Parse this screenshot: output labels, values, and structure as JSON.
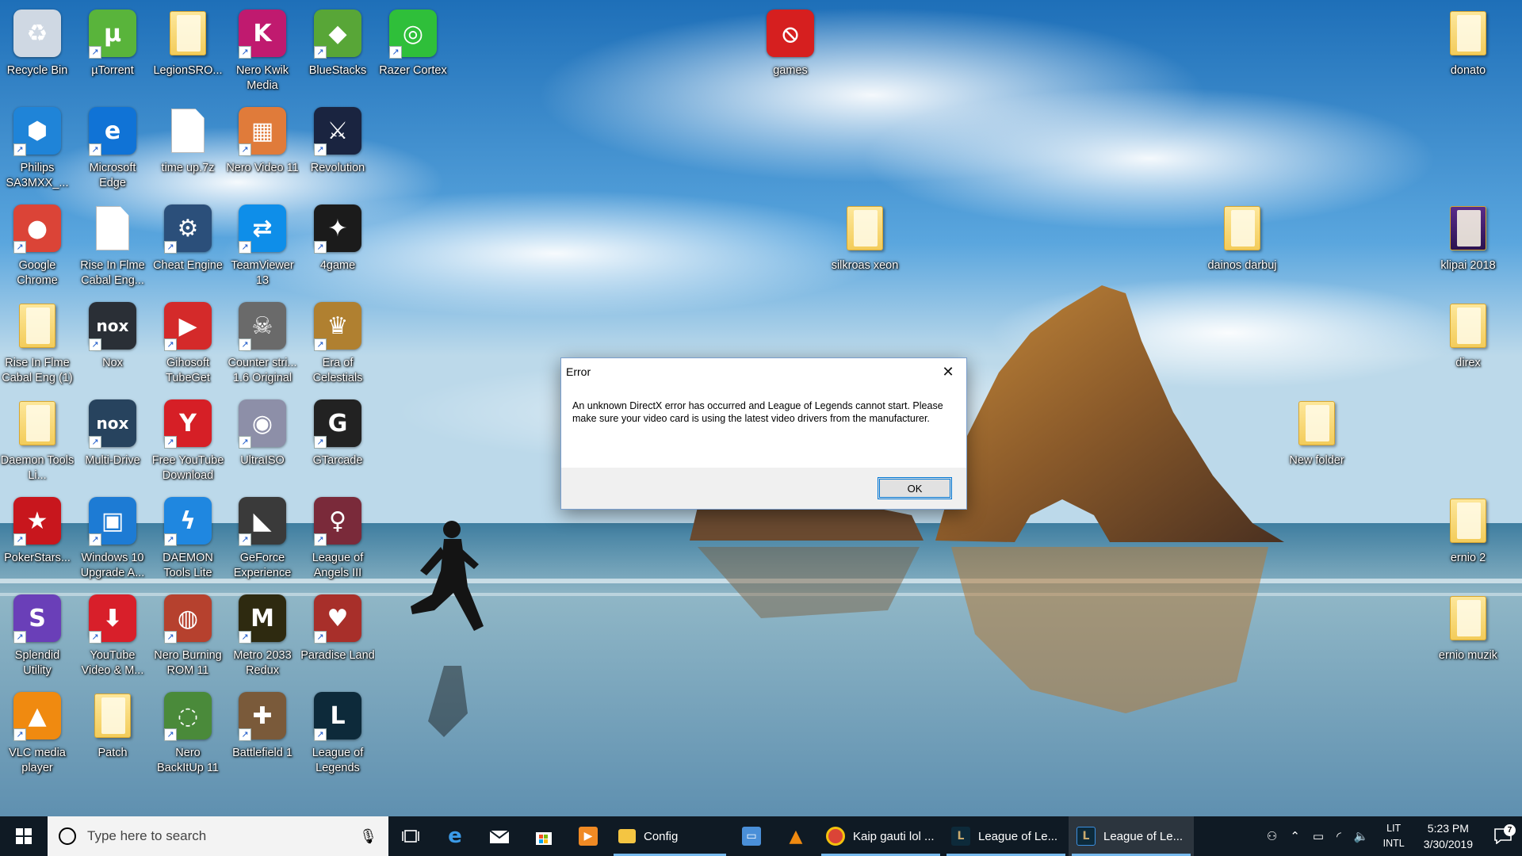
{
  "desktop": {
    "icons": [
      {
        "label": "Recycle Bin",
        "icon": "recycle-bin-icon",
        "glyph": "♻",
        "color": "#cfd8e3"
      },
      {
        "label": "µTorrent",
        "icon": "utorrent-icon",
        "glyph": "µ",
        "color": "#59b43b"
      },
      {
        "label": "LegionSRO...",
        "icon": "folder-icon"
      },
      {
        "label": "Nero Kwik Media",
        "icon": "nero-kwik-media-icon",
        "glyph": "K",
        "color": "#c01a6f"
      },
      {
        "label": "BlueStacks",
        "icon": "bluestacks-icon",
        "glyph": "◆",
        "color": "#58a637"
      },
      {
        "label": "Razer Cortex",
        "icon": "razer-cortex-icon",
        "glyph": "◎",
        "color": "#2fbf3a"
      },
      {
        "label": "Philips SA3MXX_...",
        "icon": "philips-icon",
        "glyph": "⬢",
        "color": "#1f84d8"
      },
      {
        "label": "Microsoft Edge",
        "icon": "edge-icon",
        "glyph": "e",
        "color": "#1073d6"
      },
      {
        "label": "time up.7z",
        "icon": "file-icon"
      },
      {
        "label": "Nero Video 11",
        "icon": "nero-video-icon",
        "glyph": "▦",
        "color": "#e07b3a"
      },
      {
        "label": "Revolution",
        "icon": "revolution-icon",
        "glyph": "⚔",
        "color": "#1a2440"
      },
      {
        "label": "Google Chrome",
        "icon": "chrome-icon",
        "glyph": "●",
        "color": "#db4437"
      },
      {
        "label": "Rise In Flme Cabal Eng...",
        "icon": "file-icon"
      },
      {
        "label": "Cheat Engine",
        "icon": "cheat-engine-icon",
        "glyph": "⚙",
        "color": "#2b4f7a"
      },
      {
        "label": "TeamViewer 13",
        "icon": "teamviewer-icon",
        "glyph": "⇄",
        "color": "#0e8ee9"
      },
      {
        "label": "4game",
        "icon": "4game-icon",
        "glyph": "✦",
        "color": "#1b1b1b"
      },
      {
        "label": "Rise In Flme Cabal Eng (1)",
        "icon": "folder-icon"
      },
      {
        "label": "Nox",
        "icon": "nox-icon",
        "glyph": "nox",
        "color": "#2a2f36"
      },
      {
        "label": "Gihosoft TubeGet",
        "icon": "tubeget-icon",
        "glyph": "▶",
        "color": "#d42a2a"
      },
      {
        "label": "Counter stri... 1.6 Original",
        "icon": "counter-strike-icon",
        "glyph": "☠",
        "color": "#6a6a6a"
      },
      {
        "label": "Era of Celestials",
        "icon": "era-of-celestials-icon",
        "glyph": "♛",
        "color": "#b08030"
      },
      {
        "label": "Daemon Tools Li...",
        "icon": "folder-icon"
      },
      {
        "label": "Multi-Drive",
        "icon": "multi-drive-icon",
        "glyph": "nox",
        "color": "#27435e"
      },
      {
        "label": "Free YouTube Download",
        "icon": "free-youtube-download-icon",
        "glyph": "Y",
        "color": "#d61f26"
      },
      {
        "label": "UltraISO",
        "icon": "ultraiso-icon",
        "glyph": "◉",
        "color": "#8d8fa8"
      },
      {
        "label": "GTarcade",
        "icon": "gtarcade-icon",
        "glyph": "G",
        "color": "#222222"
      },
      {
        "label": "PokerStars...",
        "icon": "pokerstars-icon",
        "glyph": "★",
        "color": "#c8161d"
      },
      {
        "label": "Windows 10 Upgrade A...",
        "icon": "windows-upgrade-icon",
        "glyph": "▣",
        "color": "#1d7bd4"
      },
      {
        "label": "DAEMON Tools Lite",
        "icon": "daemon-tools-icon",
        "glyph": "ϟ",
        "color": "#1f87e0"
      },
      {
        "label": "GeForce Experience",
        "icon": "geforce-icon",
        "glyph": "◣",
        "color": "#3a3a3a"
      },
      {
        "label": "League of Angels III",
        "icon": "league-of-angels-icon",
        "glyph": "♀",
        "color": "#7a2a3a"
      },
      {
        "label": "Splendid Utility",
        "icon": "splendid-utility-icon",
        "glyph": "S",
        "color": "#6a3fb8"
      },
      {
        "label": "YouTube Video & M...",
        "icon": "youtube-downloader-icon",
        "glyph": "⬇",
        "color": "#d81f2a"
      },
      {
        "label": "Nero Burning ROM 11",
        "icon": "nero-burning-rom-icon",
        "glyph": "◍",
        "color": "#b6412e"
      },
      {
        "label": "Metro 2033 Redux",
        "icon": "metro-2033-icon",
        "glyph": "M",
        "color": "#2e2a10"
      },
      {
        "label": "Paradise Land",
        "icon": "paradise-land-icon",
        "glyph": "♥",
        "color": "#a82f2a"
      },
      {
        "label": "VLC media player",
        "icon": "vlc-icon",
        "glyph": "▲",
        "color": "#f08a10"
      },
      {
        "label": "Patch",
        "icon": "folder-icon"
      },
      {
        "label": "Nero BackItUp 11",
        "icon": "nero-backitup-icon",
        "glyph": "◌",
        "color": "#4a8a3a"
      },
      {
        "label": "Battlefield 1",
        "icon": "battlefield-icon",
        "glyph": "✚",
        "color": "#7a5a3a"
      },
      {
        "label": "League of Legends",
        "icon": "league-of-legends-icon",
        "glyph": "L",
        "color": "#0d2a3a"
      },
      {
        "label": "games",
        "icon": "no-entry-icon",
        "glyph": "⦸",
        "color": "#d61f1f"
      },
      {
        "label": "donato",
        "icon": "folder-icon"
      },
      {
        "label": "silkroas xeon",
        "icon": "folder-icon"
      },
      {
        "label": "dainos darbuj",
        "icon": "music-folder-icon"
      },
      {
        "label": "klipai 2018",
        "icon": "video-folder-icon"
      },
      {
        "label": "direx",
        "icon": "folder-icon"
      },
      {
        "label": "New folder",
        "icon": "folder-icon"
      },
      {
        "label": "ernio 2",
        "icon": "music-folder-icon"
      },
      {
        "label": "ernio muzik",
        "icon": "music-folder-icon"
      }
    ]
  },
  "dialog": {
    "title": "Error",
    "message": "An unknown DirectX error has occurred and League of Legends cannot start.  Please make sure your video card is using the latest video drivers from the manufacturer.",
    "ok_label": "OK",
    "close_glyph": "✕"
  },
  "taskbar": {
    "search_placeholder": "Type here to search",
    "apps": [
      {
        "label": "",
        "icon": "task-view-icon"
      },
      {
        "label": "",
        "icon": "edge-icon"
      },
      {
        "label": "",
        "icon": "mail-icon"
      },
      {
        "label": "",
        "icon": "store-icon"
      },
      {
        "label": "",
        "icon": "media-player-icon"
      },
      {
        "label": "Config",
        "icon": "file-explorer-icon"
      },
      {
        "label": "",
        "icon": "network-computer-icon"
      },
      {
        "label": "",
        "icon": "vlc-icon"
      },
      {
        "label": "Kaip gauti lol ...",
        "icon": "chrome-icon"
      },
      {
        "label": "League of Le...",
        "icon": "league-of-legends-icon"
      },
      {
        "label": "League of Le...",
        "icon": "league-of-legends-icon"
      }
    ],
    "tray": {
      "language_top": "LIT",
      "language_bottom": "INTL",
      "time": "5:23 PM",
      "date": "3/30/2019",
      "notification_count": "7"
    }
  }
}
